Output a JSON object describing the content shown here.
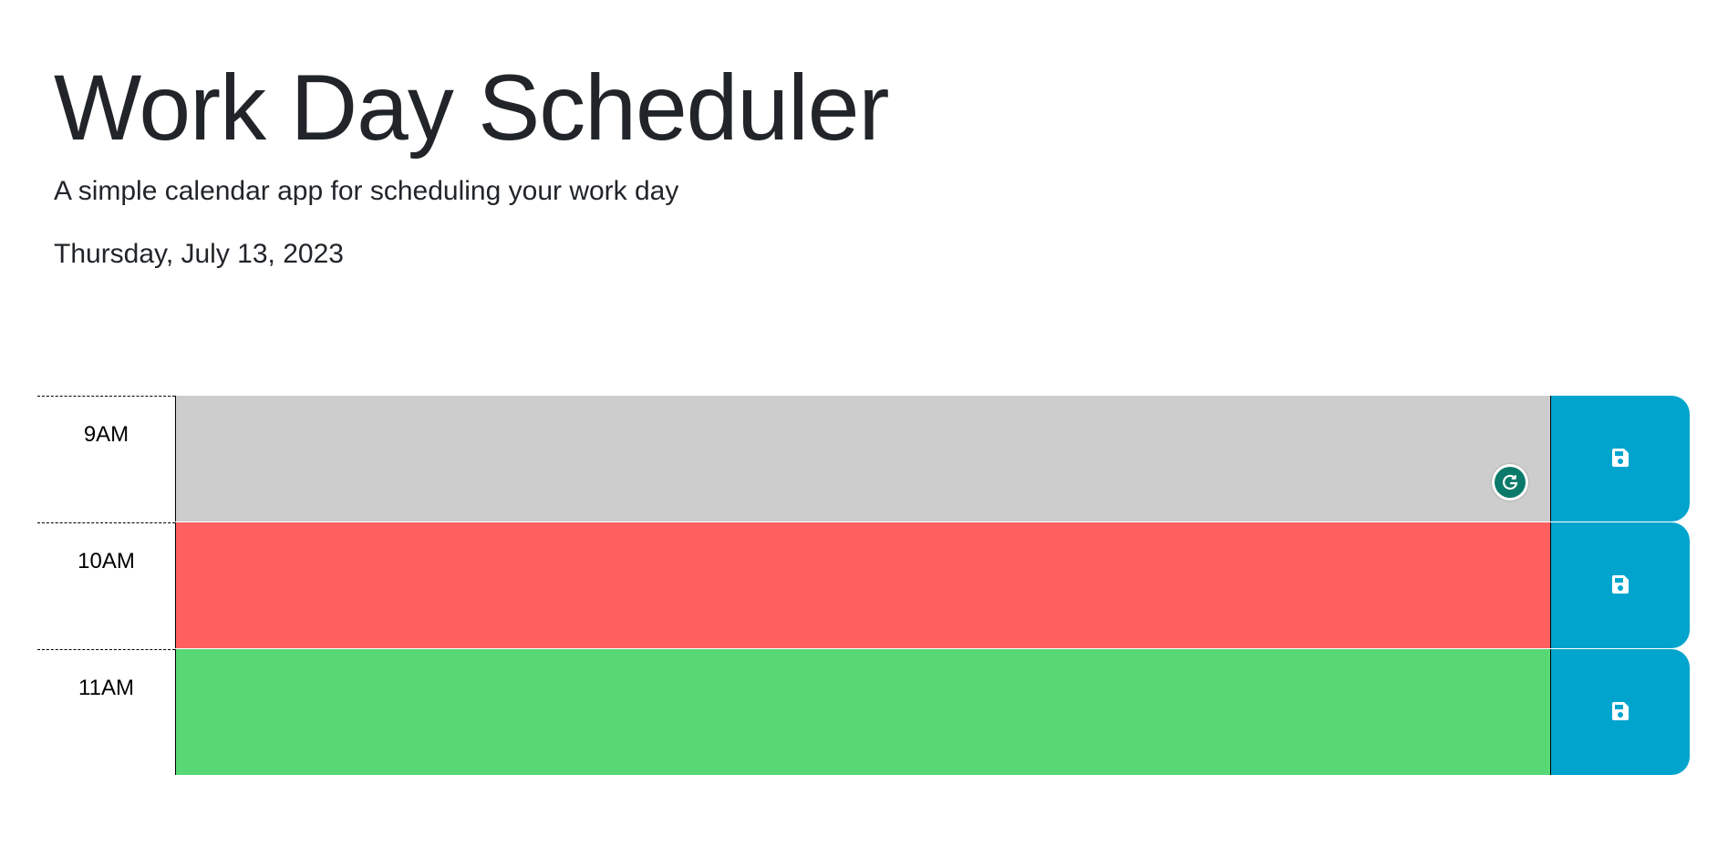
{
  "header": {
    "title": "Work Day Scheduler",
    "subtitle": "A simple calendar app for scheduling your work day",
    "current_date": "Thursday, July 13, 2023"
  },
  "time_blocks": [
    {
      "hour": "9AM",
      "status": "past",
      "text": "",
      "color": "#cdcdcd"
    },
    {
      "hour": "10AM",
      "status": "present",
      "text": "",
      "color": "#ff5f5f"
    },
    {
      "hour": "11AM",
      "status": "future",
      "text": "",
      "color": "#57d874"
    }
  ],
  "save_button": {
    "icon": "save-icon",
    "color": "#01a4cd"
  },
  "grammarly_widget": {
    "icon": "grammarly-icon",
    "color": "#0b7a6a"
  }
}
